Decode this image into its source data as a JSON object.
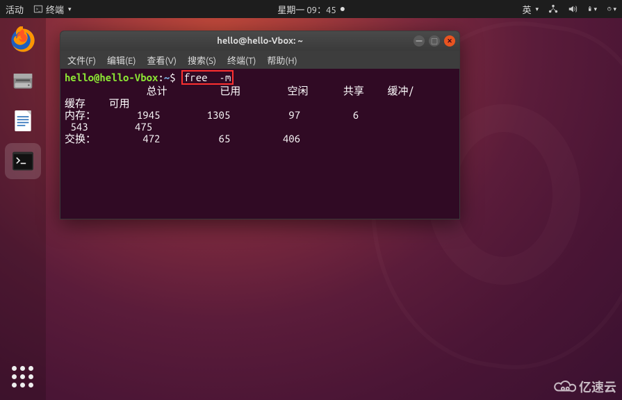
{
  "topbar": {
    "activities": "活动",
    "app_indicator": "终端",
    "clock": "星期一 09：45",
    "input_method": "英"
  },
  "dock": {
    "items": [
      {
        "name": "firefox"
      },
      {
        "name": "files"
      },
      {
        "name": "libreoffice-writer"
      },
      {
        "name": "terminal"
      }
    ]
  },
  "window": {
    "title": "hello@hello-Vbox: ~",
    "menu": {
      "file": "文件(F)",
      "edit": "编辑(E)",
      "view": "查看(V)",
      "search": "搜索(S)",
      "terminal": "终端(T)",
      "help": "帮助(H)"
    },
    "prompt": {
      "user_host": "hello@hello-Vbox",
      "path": "~",
      "command": "free  -m"
    },
    "output": {
      "headers": {
        "total": "总计",
        "used": "已用",
        "free": "空闲",
        "shared": "共享",
        "buffcache": "缓冲/"
      },
      "row2_cache": "缓存",
      "row2_avail": "可用",
      "mem_label": "内存：",
      "swap_label": "交换：",
      "mem": {
        "total": "1945",
        "used": "1305",
        "free": "97",
        "shared": "6",
        "buffcache": "543",
        "avail": "475"
      },
      "swap": {
        "total": "472",
        "used": "65",
        "free": "406"
      }
    }
  },
  "watermark": "亿速云"
}
